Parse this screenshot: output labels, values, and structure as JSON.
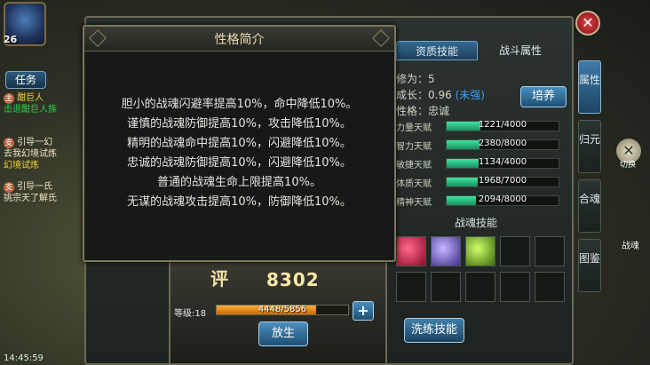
{
  "hud": {
    "player_level": "26",
    "task_button": "任务",
    "quests": [
      {
        "tag": "主",
        "title": "酣巨人",
        "detail": "击退酣巨人族"
      },
      {
        "tag": "支",
        "title": "引导一幻",
        "detail": "去我幻境试炼",
        "detail2": "幻境试炼"
      },
      {
        "tag": "支",
        "title": "引导一氏",
        "detail": "挑宗天了解氏"
      }
    ],
    "clock": "14:45:59"
  },
  "panel": {
    "tabs": [
      "资质技能",
      "战斗属性"
    ],
    "active_tab": 0,
    "cultivation": "修为：5",
    "growth_label": "成长：0.96",
    "growth_tag": "(未强)",
    "personality": "性格：忠诚",
    "train_button": "培养",
    "talents": [
      {
        "label": "力量天赋",
        "value": "1221/4000",
        "ratio": 0.305
      },
      {
        "label": "智力天赋",
        "value": "2380/8000",
        "ratio": 0.2975
      },
      {
        "label": "敏捷天赋",
        "value": "1134/4000",
        "ratio": 0.2835
      },
      {
        "label": "体质天赋",
        "value": "1968/7000",
        "ratio": 0.281
      },
      {
        "label": "精神天赋",
        "value": "2094/8000",
        "ratio": 0.262
      }
    ],
    "skills_title": "战魂技能",
    "wash_button": "洗练技能",
    "side_tabs": [
      "属性",
      "归元",
      "合魂",
      "图鉴"
    ],
    "side_active": 0,
    "switch_label": "切换",
    "battle_label": "战魂"
  },
  "stand": {
    "score_label": "评",
    "score": "8302",
    "level_label": "等级:18",
    "exp_value": "4448/5856",
    "exp_ratio": 0.7596,
    "release_button": "放生"
  },
  "popup": {
    "title": "性格简介",
    "lines": [
      "胆小的战魂闪避率提高10%，命中降低10%。",
      "谨慎的战魂防御提高10%，攻击降低10%。",
      "精明的战魂命中提高10%，闪避降低10%。",
      "忠诚的战魂防御提高10%，闪避降低10%。",
      "普通的战魂生命上限提高10%。",
      "无谋的战魂攻击提高10%，防御降低10%。"
    ]
  },
  "colors": {
    "accent_blue": "#39a0ff",
    "talent_bar": "#3fe6a0",
    "exp_bar": "#ffad3a",
    "close": "#e4434a"
  }
}
